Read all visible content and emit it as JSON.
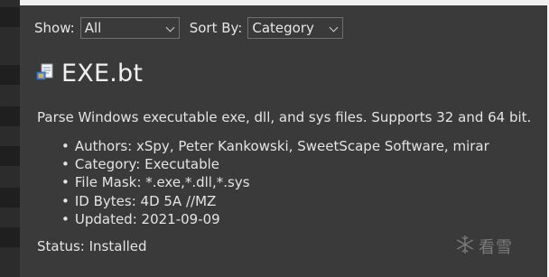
{
  "toolbar": {
    "show_label": "Show:",
    "show_value": "All",
    "sort_label": "Sort By:",
    "sort_value": "Category"
  },
  "template": {
    "icon": "script-file-icon",
    "title": "EXE.bt",
    "description": "Parse Windows executable exe, dll, and sys files. Supports 32 and 64 bit.",
    "details": [
      {
        "label": "Authors:",
        "value": "xSpy, Peter Kankowski, SweetScape Software, mirar"
      },
      {
        "label": "Category:",
        "value": "Executable"
      },
      {
        "label": "File Mask:",
        "value": "*.exe,*.dll,*.sys"
      },
      {
        "label": "ID Bytes:",
        "value": "4D 5A //MZ"
      },
      {
        "label": "Updated:",
        "value": "2021-09-09"
      }
    ],
    "status": "Status: Installed"
  },
  "watermark": {
    "icon": "snowflake-icon",
    "text": "看雪"
  },
  "colors": {
    "background": "#3a3a3a",
    "text": "#e4e4e4",
    "border": "#6f6f6f"
  }
}
